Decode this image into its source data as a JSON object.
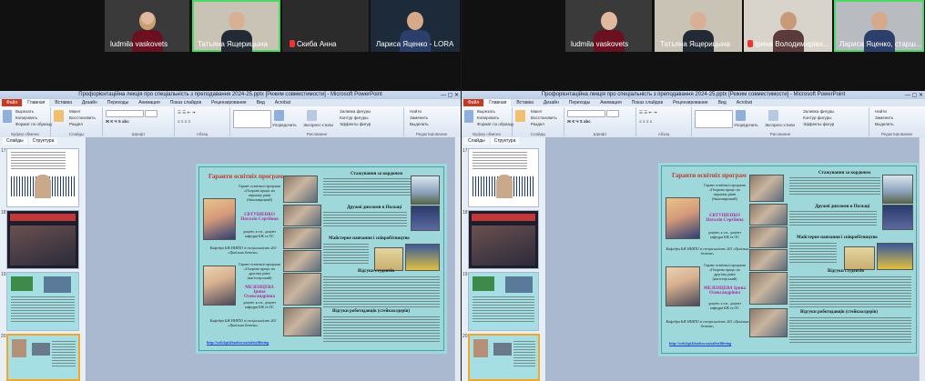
{
  "left": {
    "participants": [
      {
        "name": "ludmila vaskovets",
        "muted": false,
        "active": false
      },
      {
        "name": "Татьяна Ящерицына",
        "muted": false,
        "active": true
      },
      {
        "name": "Скиба Анна",
        "muted": true,
        "active": false
      },
      {
        "name": "Лариса Яценко - LORA",
        "muted": false,
        "active": false
      }
    ],
    "ppt": {
      "title": "Профорієнтаційна лекція про  спеціальність з преподавання 2024-25.pptx [Режим совместимости] - Microsoft PowerPoint",
      "ribbon_tabs": [
        "Файл",
        "Главная",
        "Вставка",
        "Дизайн",
        "Переходы",
        "Анимация",
        "Показ слайдов",
        "Рецензирование",
        "Вид",
        "Acrobat"
      ],
      "ribbon_groups": [
        "Буфер обмена",
        "Слайды",
        "Шрифт",
        "Абзац",
        "Рисование",
        "Редактирование"
      ],
      "clipboard": [
        "Вырезать",
        "Копировать",
        "Формат по образцу"
      ],
      "slides_btns": [
        "Создать слайд",
        "Макет",
        "Восстановить",
        "Раздел"
      ],
      "draw_btns": [
        "Упорядочить",
        "Экспресс-стили",
        "Заливка фигуры",
        "Контур фигуры",
        "Эффекты фигур"
      ],
      "edit_btns": [
        "Найти",
        "Заменить",
        "Выделить"
      ],
      "pane_tabs": [
        "Слайды",
        "Структура"
      ],
      "slide_numbers": [
        "17",
        "18",
        "19",
        "20"
      ]
    }
  },
  "right": {
    "participants": [
      {
        "name": "ludmila vaskovets",
        "muted": false,
        "active": false
      },
      {
        "name": "Татьяна Ящерицына",
        "muted": false,
        "active": false
      },
      {
        "name": "Ірина Володимирівн...",
        "muted": true,
        "active": false
      },
      {
        "name": "Лариса Яценко, старш...",
        "muted": false,
        "active": true
      }
    ],
    "ppt": {
      "title": "Профорієнтаційна лекція про  спеціальність з преподавання 2024-25.pptx [Режим совместимости] - Microsoft PowerPoint",
      "ribbon_tabs": [
        "Файл",
        "Главная",
        "Вставка",
        "Дизайн",
        "Переходы",
        "Анимация",
        "Показ слайдов",
        "Рецензирование",
        "Вид",
        "Acrobat"
      ],
      "ribbon_groups": [
        "Буфер обмена",
        "Слайды",
        "Шрифт",
        "Абзац",
        "Рисование",
        "Редактирование"
      ],
      "clipboard": [
        "Вырезать",
        "Копировать",
        "Формат по образцу"
      ],
      "slides_btns": [
        "Создать слайд",
        "Макет",
        "Восстановить",
        "Раздел"
      ],
      "draw_btns": [
        "Упорядочить",
        "Экспресс-стили",
        "Заливка фигуры",
        "Контур фигуры",
        "Эффекты фигур"
      ],
      "edit_btns": [
        "Найти",
        "Заменить",
        "Выделить"
      ],
      "pane_tabs": [
        "Слайды",
        "Структура"
      ],
      "slide_numbers": [
        "17",
        "18",
        "19",
        "20"
      ]
    }
  },
  "slide": {
    "title": "Гаранти освітніх програм",
    "guarantor1": {
      "intro": "Гарант освітньої програми «Охорона праці» на першому рівні (бакалаврський)",
      "name": "ЄВТУШЕНКО Наталія Сергіївна",
      "role": "доцент, к.т.н., доцент кафедри БЖ та ОС"
    },
    "guarantor2": {
      "intro": "Гарант освітньої програми «Охорона праці» на другому рівні (магістерський)",
      "name": "МЕЗЕНЦЕВА Ірина Олександрівна",
      "role": "доцент, к.т.н., доцент кафедри БЖ та ОС"
    },
    "dept1": "Кафедра БЖ ННІПО зі спеціальністю 263 «Цивільна безпека»",
    "dept2": "Кафедра БЖ ННІПО зі спеціальністю 263 «Цивільна безпека»",
    "link": "http://web.kpi.kharkov.ua/safetylifering",
    "h_internship": "Стажування за кордоном",
    "h_diploma": "Дружні дипломи в Польщі",
    "h_masters": "Майстерне навчання і співробітництво",
    "h_grads": "Відгуки студентів",
    "h_employers": "Відгуки роботодавців (стейкхолдерів)"
  }
}
